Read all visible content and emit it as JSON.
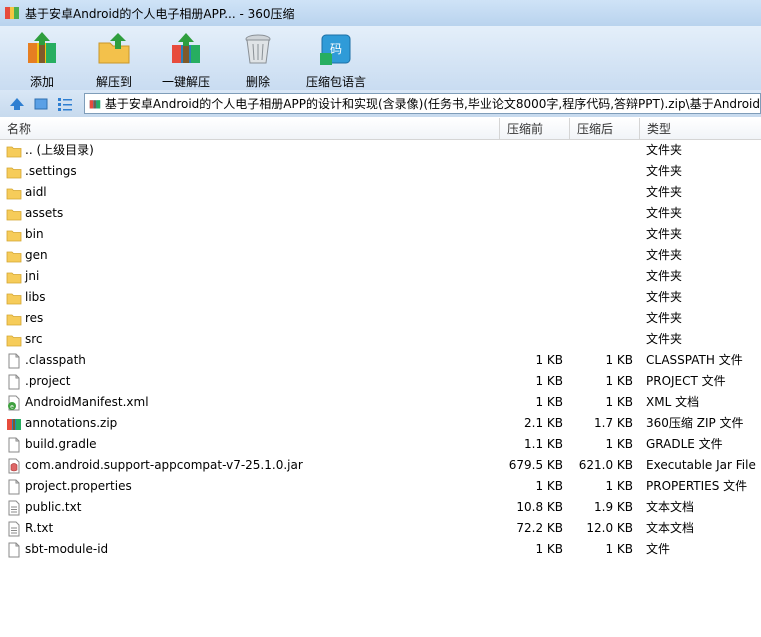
{
  "window": {
    "title": "基于安卓Android的个人电子相册APP... - 360压缩"
  },
  "toolbar": {
    "items": [
      {
        "label": "添加",
        "icon": "add-archive-icon"
      },
      {
        "label": "解压到",
        "icon": "extract-to-icon"
      },
      {
        "label": "一键解压",
        "icon": "one-click-extract-icon"
      },
      {
        "label": "删除",
        "icon": "delete-icon"
      },
      {
        "label": "压缩包语言",
        "icon": "archive-language-icon"
      }
    ]
  },
  "address": {
    "path": "基于安卓Android的个人电子相册APP的设计和实现(含录像)(任务书,毕业论文8000字,程序代码,答辩PPT).zip\\基于Android"
  },
  "columns": {
    "name": "名称",
    "packed": "压缩前",
    "size": "压缩后",
    "type": "类型"
  },
  "files": [
    {
      "name": ".. (上级目录)",
      "packed": "",
      "size": "",
      "type": "文件夹",
      "icon": "folder-icon"
    },
    {
      "name": ".settings",
      "packed": "",
      "size": "",
      "type": "文件夹",
      "icon": "folder-icon"
    },
    {
      "name": "aidl",
      "packed": "",
      "size": "",
      "type": "文件夹",
      "icon": "folder-icon"
    },
    {
      "name": "assets",
      "packed": "",
      "size": "",
      "type": "文件夹",
      "icon": "folder-icon"
    },
    {
      "name": "bin",
      "packed": "",
      "size": "",
      "type": "文件夹",
      "icon": "folder-icon"
    },
    {
      "name": "gen",
      "packed": "",
      "size": "",
      "type": "文件夹",
      "icon": "folder-icon"
    },
    {
      "name": "jni",
      "packed": "",
      "size": "",
      "type": "文件夹",
      "icon": "folder-icon"
    },
    {
      "name": "libs",
      "packed": "",
      "size": "",
      "type": "文件夹",
      "icon": "folder-icon"
    },
    {
      "name": "res",
      "packed": "",
      "size": "",
      "type": "文件夹",
      "icon": "folder-icon"
    },
    {
      "name": "src",
      "packed": "",
      "size": "",
      "type": "文件夹",
      "icon": "folder-icon"
    },
    {
      "name": ".classpath",
      "packed": "1 KB",
      "size": "1 KB",
      "type": "CLASSPATH 文件",
      "icon": "file-icon"
    },
    {
      "name": ".project",
      "packed": "1 KB",
      "size": "1 KB",
      "type": "PROJECT 文件",
      "icon": "file-icon"
    },
    {
      "name": "AndroidManifest.xml",
      "packed": "1 KB",
      "size": "1 KB",
      "type": "XML 文档",
      "icon": "xml-file-icon"
    },
    {
      "name": "annotations.zip",
      "packed": "2.1 KB",
      "size": "1.7 KB",
      "type": "360压缩 ZIP 文件",
      "icon": "zip-file-icon"
    },
    {
      "name": "build.gradle",
      "packed": "1.1 KB",
      "size": "1 KB",
      "type": "GRADLE 文件",
      "icon": "file-icon"
    },
    {
      "name": "com.android.support-appcompat-v7-25.1.0.jar",
      "packed": "679.5 KB",
      "size": "621.0 KB",
      "type": "Executable Jar File",
      "icon": "jar-file-icon"
    },
    {
      "name": "project.properties",
      "packed": "1 KB",
      "size": "1 KB",
      "type": "PROPERTIES 文件",
      "icon": "file-icon"
    },
    {
      "name": "public.txt",
      "packed": "10.8 KB",
      "size": "1.9 KB",
      "type": "文本文档",
      "icon": "text-file-icon"
    },
    {
      "name": "R.txt",
      "packed": "72.2 KB",
      "size": "12.0 KB",
      "type": "文本文档",
      "icon": "text-file-icon"
    },
    {
      "name": "sbt-module-id",
      "packed": "1 KB",
      "size": "1 KB",
      "type": "文件",
      "icon": "file-icon"
    }
  ]
}
